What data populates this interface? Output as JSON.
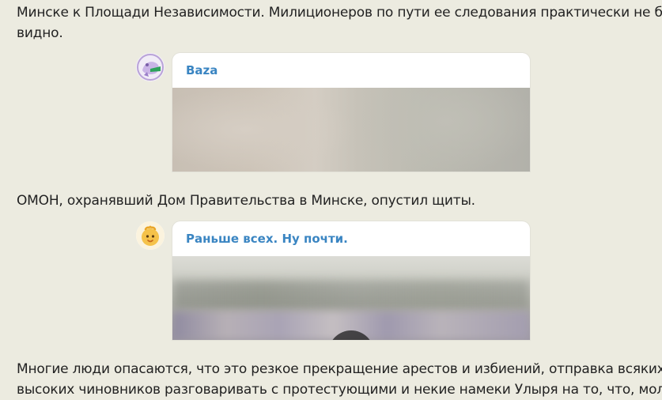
{
  "article": {
    "paragraph_top": "Минске к Площади Независимости. Милиционеров по пути ее следования практически не было",
    "paragraph_top_2": "видно.",
    "paragraph_mid": "ОМОН, охранявший Дом Правительства в Минске, опустил щиты.",
    "paragraph_bottom": "Многие люди опасаются, что это резкое прекращение арестов и избиений, отправка всяких",
    "paragraph_bottom_2": "высоких чиновников разговаривать с протестующими и некие намеки Улыря на то, что, мол"
  },
  "embeds": [
    {
      "channel": "Baza",
      "avatar_icon": "baza-avatar-icon",
      "media": "blurred-photo"
    },
    {
      "channel": "Раньше всех. Ну почти.",
      "avatar_icon": "chick-avatar-icon",
      "media": "blurred-video",
      "has_play_button": true
    }
  ],
  "colors": {
    "page_background": "#ecebe0",
    "channel_name": "#3a85c2"
  }
}
